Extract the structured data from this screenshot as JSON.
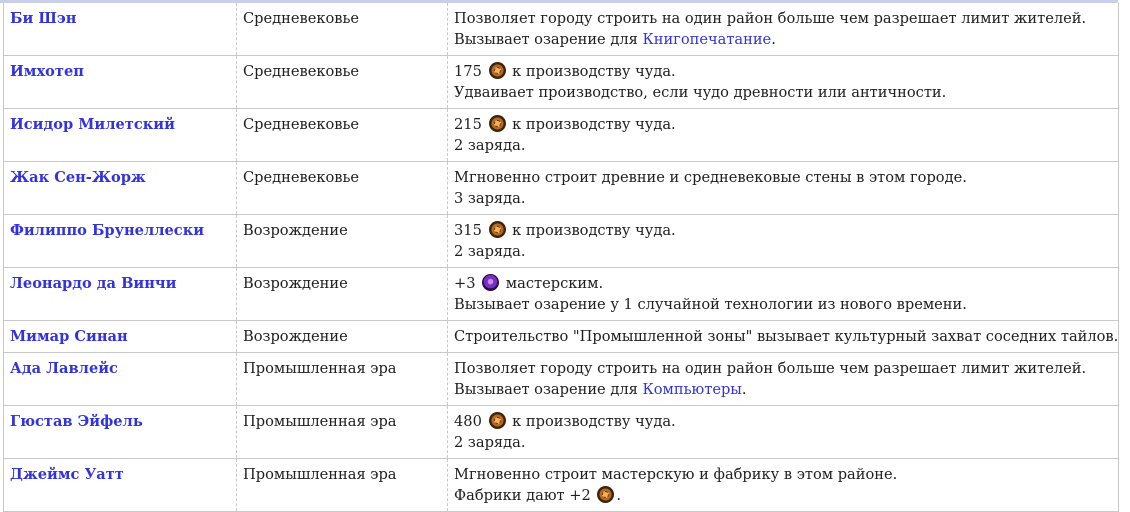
{
  "rows": [
    {
      "name": "Би Шэн",
      "era": "Средневековье",
      "l1": "Позволяет городу строить на один район больше чем разрешает лимит жителей.",
      "l2_pre": "Вызывает озарение для ",
      "l2_link": "Книгопечатание",
      "l2_post": "."
    },
    {
      "name": "Имхотеп",
      "era": "Средневековье",
      "l1_num": "175",
      "l1_rest": "к производству чуда.",
      "l2": "Удваивает производство, если чудо древности или античности."
    },
    {
      "name": "Исидор Милетский",
      "era": "Средневековье",
      "l1_num": "215",
      "l1_rest": "к производству чуда.",
      "l2": "2 заряда."
    },
    {
      "name": "Жак Сен-Жорж",
      "era": "Средневековье",
      "l1": "Мгновенно строит древние и средневековые стены в этом городе.",
      "l2": "3 заряда."
    },
    {
      "name": "Филиппо Брунеллески",
      "era": "Возрождение",
      "l1_num": "315",
      "l1_rest": "к производству чуда.",
      "l2": "2 заряда."
    },
    {
      "name": "Леонардо да Винчи",
      "era": "Возрождение",
      "l1_num": "+3",
      "l1_rest": "мастерским.",
      "l2": "Вызывает озарение у 1 случайной технологии из нового времени."
    },
    {
      "name": "Мимар Синан",
      "era": "Возрождение",
      "l1": "Строительство \"Промышленной зоны\" вызывает культурный захват соседних тайлов."
    },
    {
      "name": "Ада Лавлейс",
      "era": "Промышленная эра",
      "l1": "Позволяет городу строить на один район больше чем разрешает лимит жителей.",
      "l2_pre": "Вызывает озарение для ",
      "l2_link": "Компьютеры",
      "l2_post": "."
    },
    {
      "name": "Гюстав Эйфель",
      "era": "Промышленная эра",
      "l1_num": "480",
      "l1_rest": "к производству чуда.",
      "l2": "2 заряда."
    },
    {
      "name": "Джеймс Уатт",
      "era": "Промышленная эра",
      "l1": "Мгновенно строит мастерскую и фабрику в этом районе.",
      "l2_pre": "Фабрики дают +2",
      "l2_post": "."
    }
  ],
  "icons": {
    "production": "production-icon",
    "great_person": "great-person-icon"
  }
}
